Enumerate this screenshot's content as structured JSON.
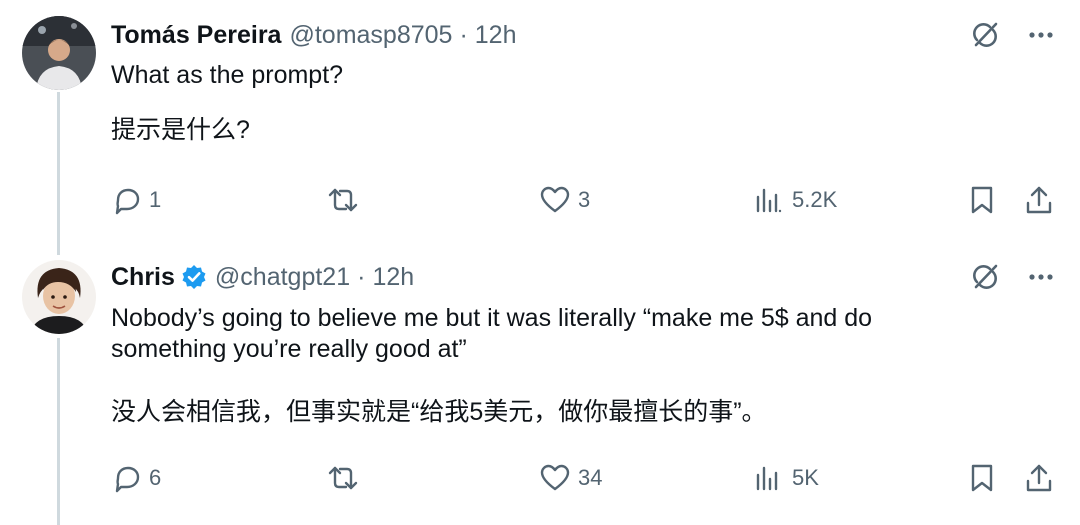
{
  "tweets": [
    {
      "name": "Tomás Pereira",
      "handle": "@tomasp8705",
      "separator": "·",
      "time": "12h",
      "verified": false,
      "text_en": "What as the prompt?",
      "text_zh": "提示是什么?",
      "replies": "1",
      "reposts": "",
      "likes": "3",
      "views": "5.2K"
    },
    {
      "name": "Chris",
      "handle": "@chatgpt21",
      "separator": "·",
      "time": "12h",
      "verified": true,
      "text_en": "Nobody’s going to believe me but it was literally “make me 5$ and do something you’re really good at”",
      "text_zh": "没人会相信我，但事实就是“给我5美元，做你最擅长的事”。",
      "replies": "6",
      "reposts": "",
      "likes": "34",
      "views": "5K"
    }
  ],
  "colors": {
    "text": "#0f1419",
    "secondary": "#536471",
    "verified": "#1d9bf0",
    "thread_line": "#cfd9de"
  },
  "icons": [
    "grok-icon",
    "more-icon",
    "reply-icon",
    "repost-icon",
    "like-icon",
    "views-icon",
    "bookmark-icon",
    "share-icon",
    "verified-badge-icon"
  ]
}
